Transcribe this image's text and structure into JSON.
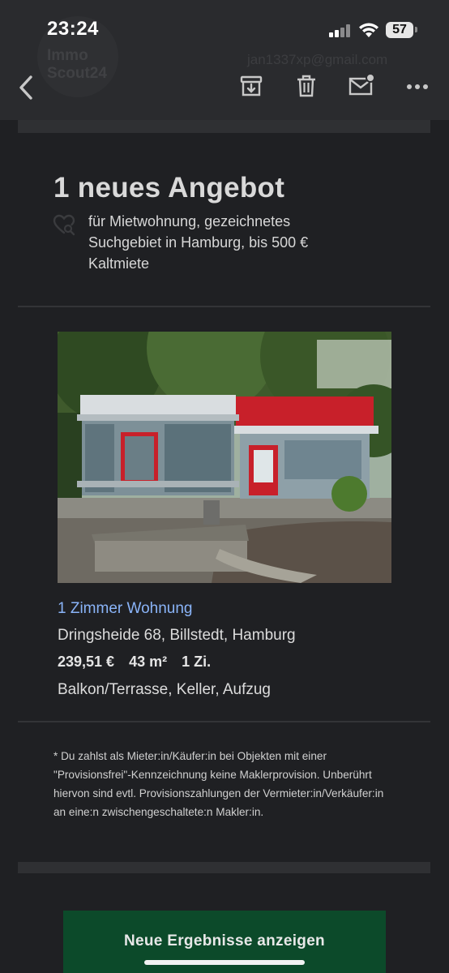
{
  "status_bar": {
    "time": "23:24",
    "battery": "57"
  },
  "header_ghost": {
    "logo_text": "Immo Scout24",
    "email": "jan1337xp@gmail.com"
  },
  "toolbar": {
    "back": "back-arrow-icon",
    "archive": "archive-icon",
    "delete": "trash-icon",
    "mark_unread": "mail-unread-icon",
    "more": "more-horizontal-icon"
  },
  "offer": {
    "title": "1 neues Angebot",
    "description": "für  Mietwohnung, gezeichnetes Suchgebiet in Hamburg, bis 500 € Kaltmiete"
  },
  "listing": {
    "name": "1 Zimmer Wohnung",
    "address": "Dringsheide 68, Billstedt, Hamburg",
    "price": "239,51 €",
    "area": "43 m²",
    "rooms": "1 Zi.",
    "features": "Balkon/Terrasse, Keller, Aufzug"
  },
  "disclaimer": "* Du zahlst als Mieter:in/Käufer:in bei Objekten mit einer \"Provisionsfrei\"-Kennzeichnung keine Maklerprovision. Unberührt hiervon sind evtl. Provisionszahlungen der Vermieter:in/Verkäufer:in an eine:n zwischengeschaltete:n Makler:in.",
  "cta": {
    "label": "Neue Ergebnisse anzeigen"
  },
  "colors": {
    "background": "#1f2023",
    "link": "#8ab4f8",
    "cta": "#0c4a2a"
  }
}
